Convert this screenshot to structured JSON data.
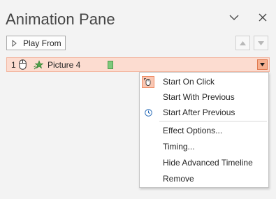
{
  "pane": {
    "title": "Animation Pane",
    "collapse_icon": "chevron-down-icon",
    "close_icon": "close-icon"
  },
  "toolbar": {
    "play_from_label": "Play From",
    "play_icon": "play-icon",
    "move_up_icon": "arrow-up-icon",
    "move_down_icon": "arrow-down-icon"
  },
  "animation_item": {
    "index": "1",
    "trigger_icon": "mouse-icon",
    "effect_icon": "star-effect-icon",
    "name": "Picture 4",
    "timeline_color": "#7ec97b",
    "selected_bg": "#fcdcd0"
  },
  "context_menu": {
    "items": [
      {
        "label": "Start On Click",
        "icon": "mouse-click-icon",
        "checked": true
      },
      {
        "label": "Start With Previous",
        "icon": "",
        "checked": false
      },
      {
        "label": "Start After Previous",
        "icon": "clock-icon",
        "checked": false
      },
      {
        "label": "Effect Options...",
        "icon": "",
        "checked": false
      },
      {
        "label": "Timing...",
        "icon": "",
        "checked": false
      },
      {
        "label": "Hide Advanced Timeline",
        "icon": "",
        "checked": false
      },
      {
        "label": "Remove",
        "icon": "",
        "checked": false
      }
    ]
  }
}
